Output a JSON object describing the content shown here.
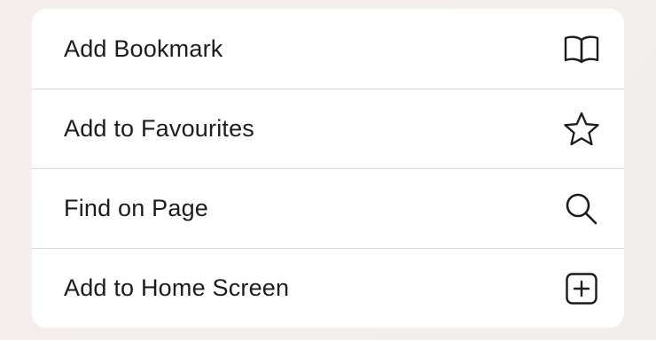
{
  "menu": {
    "items": [
      {
        "label": "Add Bookmark",
        "icon": "book-icon"
      },
      {
        "label": "Add to Favourites",
        "icon": "star-icon"
      },
      {
        "label": "Find on Page",
        "icon": "magnifier-icon"
      },
      {
        "label": "Add to Home Screen",
        "icon": "plus-square-icon"
      }
    ]
  },
  "colors": {
    "text": "#1c1c1e",
    "separator": "#d9d9db",
    "background": "#f4eeec",
    "panel": "#ffffff"
  }
}
